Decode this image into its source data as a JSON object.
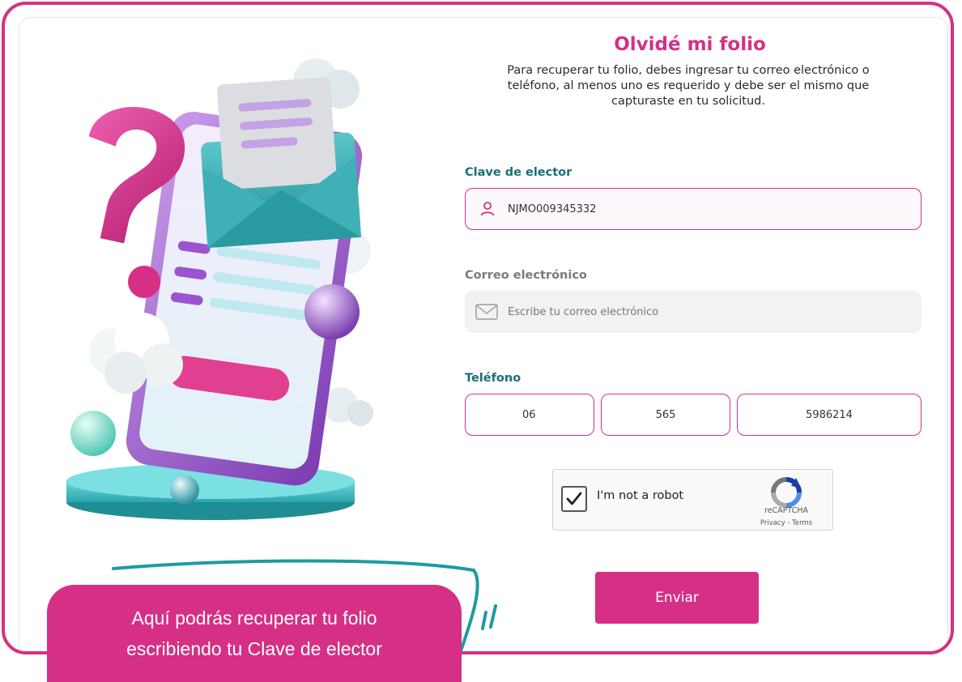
{
  "form": {
    "title": "Olvidé mi folio",
    "description": "Para recuperar tu folio, debes ingresar tu correo electrónico o teléfono, al menos uno es requerido y debe ser el mismo que capturaste en tu solicitud.",
    "clave_label": "Clave de elector",
    "clave_value": "NJMO009345332",
    "correo_label": "Correo electrónico",
    "correo_placeholder": "Escribe tu correo electrónico",
    "telefono_label": "Teléfono",
    "telefono": [
      "06",
      "565",
      "5986214"
    ],
    "submit_label": "Enviar"
  },
  "recaptcha": {
    "label": "I'm not a robot",
    "brand": "reCAPTCHA",
    "links": "Privacy - Terms",
    "checked": true
  },
  "callout": {
    "line1": "Aquí podrás recuperar tu folio",
    "line2": "escribiendo tu Clave de elector"
  },
  "colors": {
    "accent": "#d62f86",
    "teal": "#17707a"
  }
}
